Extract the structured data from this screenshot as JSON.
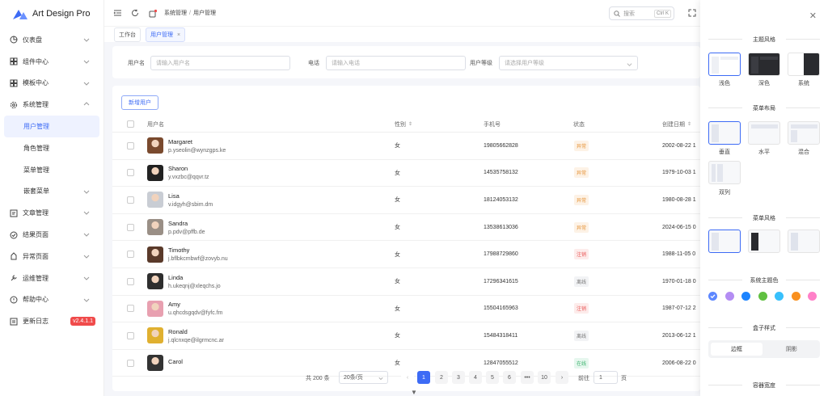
{
  "app": {
    "title": "Art Design Pro",
    "version_badge": "v2.4.1.1"
  },
  "sidebar": {
    "items": [
      {
        "label": "仪表盘",
        "icon": "dashboard-icon"
      },
      {
        "label": "组件中心",
        "icon": "components-icon"
      },
      {
        "label": "模板中心",
        "icon": "template-icon"
      },
      {
        "label": "系统管理",
        "icon": "settings-icon"
      },
      {
        "label": "文章管理",
        "icon": "article-icon"
      },
      {
        "label": "结果页面",
        "icon": "result-icon"
      },
      {
        "label": "异常页面",
        "icon": "exception-icon"
      },
      {
        "label": "运维管理",
        "icon": "ops-icon"
      },
      {
        "label": "帮助中心",
        "icon": "help-icon"
      },
      {
        "label": "更新日志",
        "icon": "changelog-icon"
      }
    ],
    "system_children": [
      "用户管理",
      "角色管理",
      "菜单管理",
      "嵌套菜单"
    ]
  },
  "header": {
    "breadcrumb": [
      "系统管理",
      "用户管理"
    ],
    "search_placeholder": "搜索",
    "search_shortcut": "Ctrl K"
  },
  "tabs": [
    {
      "label": "工作台"
    },
    {
      "label": "用户管理",
      "close": "×"
    }
  ],
  "filters": {
    "username_label": "用户名",
    "username_placeholder": "请输入用户名",
    "phone_label": "电话",
    "phone_placeholder": "请输入电话",
    "level_label": "用户等级",
    "level_placeholder": "请选择用户等级"
  },
  "table": {
    "add_button": "新增用户",
    "columns": {
      "user": "用户名",
      "gender": "性别",
      "phone": "手机号",
      "status": "状态",
      "created": "创建日期"
    },
    "rows": [
      {
        "name": "Margaret",
        "email": "p.yseolin@wynzgps.ke",
        "gender": "女",
        "phone": "19805662828",
        "status": "异常",
        "status_kind": "online",
        "created": "2002-08-22 1",
        "avatar_color": "#7a4a2e"
      },
      {
        "name": "Sharon",
        "email": "y.vxzbc@qqvr.tz",
        "gender": "女",
        "phone": "14535758132",
        "status": "异常",
        "status_kind": "online",
        "created": "1979-10-03 1",
        "avatar_color": "#222222"
      },
      {
        "name": "Lisa",
        "email": "v.idgyh@sbim.dm",
        "gender": "女",
        "phone": "18124053132",
        "status": "异常",
        "status_kind": "online",
        "created": "1980-08-28 1",
        "avatar_color": "#c9cdd4"
      },
      {
        "name": "Sandra",
        "email": "p.pdv@pffb.de",
        "gender": "女",
        "phone": "13538613036",
        "status": "异常",
        "status_kind": "online",
        "created": "2024-06-15 0",
        "avatar_color": "#9a8f86"
      },
      {
        "name": "Timothy",
        "email": "j.bflbkcmbwf@zovyb.nu",
        "gender": "女",
        "phone": "17988729860",
        "status": "注销",
        "status_kind": "cancel",
        "created": "1988-11-05 0",
        "avatar_color": "#5a3a2a"
      },
      {
        "name": "Linda",
        "email": "h.ukeqnj@xleqchs.jo",
        "gender": "女",
        "phone": "17296341615",
        "status": "离线",
        "status_kind": "off",
        "created": "1970-01-18 0",
        "avatar_color": "#2e2e2e"
      },
      {
        "name": "Amy",
        "email": "u.qhcdsgqdv@fyfc.fm",
        "gender": "女",
        "phone": "15504165963",
        "status": "注销",
        "status_kind": "cancel",
        "created": "1987-07-12 2",
        "avatar_color": "#e8a0b0"
      },
      {
        "name": "Ronald",
        "email": "j.qlcnxqe@ilgrmcnc.ar",
        "gender": "女",
        "phone": "15484318411",
        "status": "离线",
        "status_kind": "off",
        "created": "2013-06-12 1",
        "avatar_color": "#e0b030"
      },
      {
        "name": "Carol",
        "email": "",
        "gender": "女",
        "phone": "12847055512",
        "status": "在线",
        "status_kind": "ok",
        "created": "2006-08-22 0",
        "avatar_color": "#333333"
      }
    ]
  },
  "pagination": {
    "total": "共 200 条",
    "page_size": "20条/页",
    "pages": [
      "1",
      "2",
      "3",
      "4",
      "5",
      "6",
      "•••",
      "10"
    ],
    "prev": "‹",
    "next": "›",
    "goto_label": "前往",
    "goto_value": "1",
    "goto_suffix": "页"
  },
  "settings": {
    "theme_style": {
      "title": "主题风格",
      "options": [
        "浅色",
        "深色",
        "系统"
      ]
    },
    "menu_layout": {
      "title": "菜单布局",
      "options": [
        "垂直",
        "水平",
        "混合",
        "双列"
      ]
    },
    "menu_style": {
      "title": "菜单风格"
    },
    "theme_color": {
      "title": "系统主题色",
      "colors": [
        "#5d87ff",
        "#b48df3",
        "#1d84ff",
        "#60c041",
        "#38c0fc",
        "#f9901f",
        "#ff80c8"
      ]
    },
    "box_style": {
      "title": "盒子样式",
      "options": [
        "边框",
        "阴影"
      ]
    },
    "container_width": {
      "title": "容器宽度"
    }
  },
  "colors": {
    "primary": "#3d6bf5"
  }
}
